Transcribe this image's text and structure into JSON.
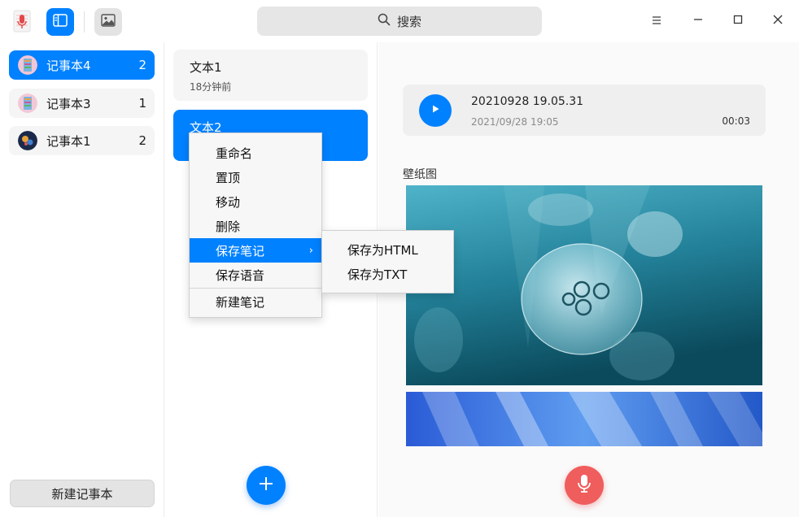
{
  "titlebar": {
    "search_placeholder": "搜索"
  },
  "sidebar": {
    "notebooks": [
      {
        "label": "记事本4",
        "count": "2",
        "active": true
      },
      {
        "label": "记事本3",
        "count": "1",
        "active": false
      },
      {
        "label": "记事本1",
        "count": "2",
        "active": false
      }
    ],
    "new_notebook_label": "新建记事本"
  },
  "notes": {
    "items": [
      {
        "title": "文本1",
        "time": "18分钟前"
      },
      {
        "title": "文本2",
        "time": ""
      }
    ]
  },
  "context_menu": {
    "items": [
      "重命名",
      "置顶",
      "移动",
      "删除",
      "保存笔记",
      "保存语音",
      "新建笔记"
    ],
    "active_item": "保存笔记",
    "submenu": [
      "保存为HTML",
      "保存为TXT"
    ]
  },
  "detail": {
    "voice": {
      "title": "20210928 19.05.31",
      "date": "2021/09/28 19:05",
      "duration": "00:03"
    },
    "wallpaper_label": "壁纸图"
  },
  "colors": {
    "accent": "#0081ff",
    "record": "#f05d5d"
  },
  "icons": [
    "app-icon",
    "sidebar-toggle-icon",
    "image-icon",
    "search-icon",
    "menu-icon",
    "minimize-icon",
    "maximize-icon",
    "close-icon",
    "play-icon",
    "plus-icon",
    "microphone-icon",
    "chevron-right-icon"
  ]
}
